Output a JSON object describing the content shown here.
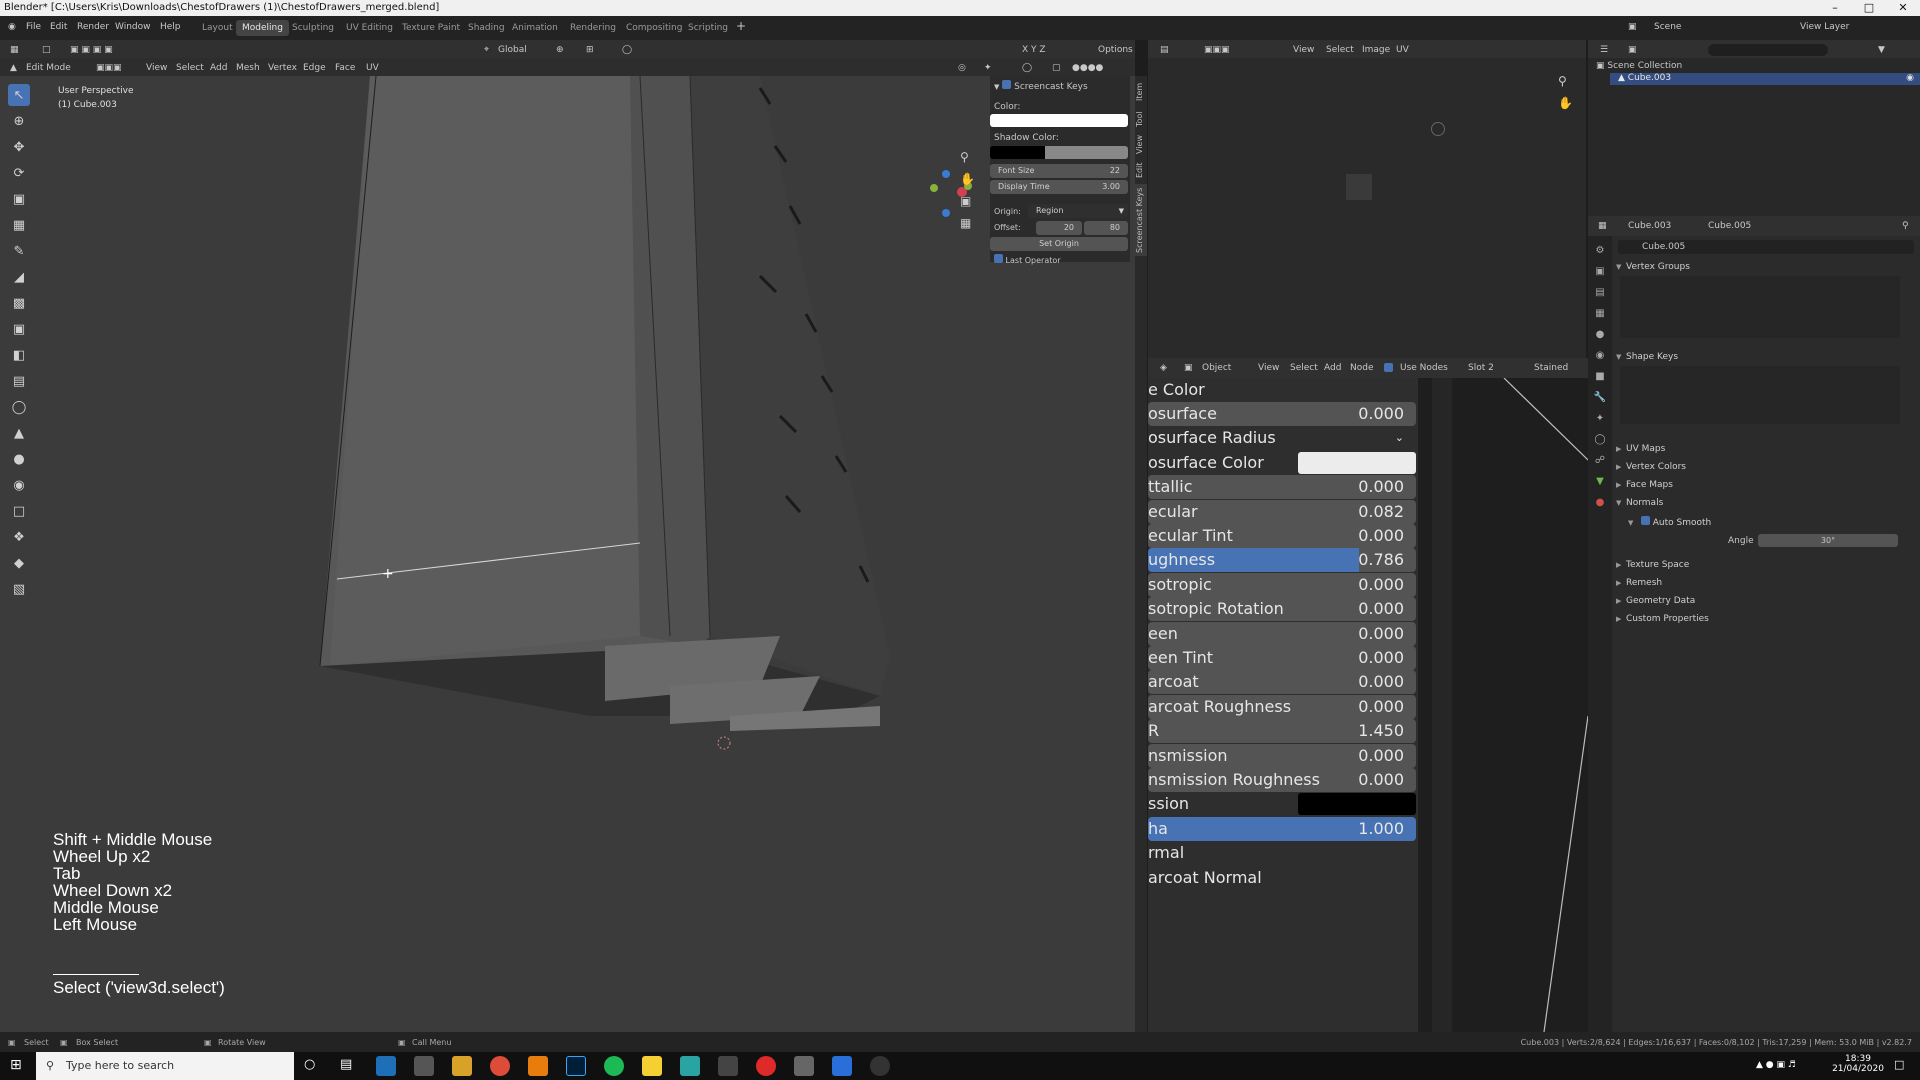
{
  "window": {
    "title": "Blender* [C:\\Users\\Kris\\Downloads\\ChestofDrawers (1)\\ChestofDrawers_merged.blend]"
  },
  "menubar": {
    "items": [
      "File",
      "Edit",
      "Render",
      "Window",
      "Help"
    ],
    "workspaces": [
      "Layout",
      "Modeling",
      "Sculpting",
      "UV Editing",
      "Texture Paint",
      "Shading",
      "Animation",
      "Rendering",
      "Compositing",
      "Scripting"
    ],
    "active_workspace": "Modeling",
    "scene_label": "Scene",
    "view_layer_label": "View Layer"
  },
  "viewport_header": {
    "orientation": "Global",
    "options": "Options",
    "mode": "Edit Mode",
    "menus": [
      "View",
      "Select",
      "Add",
      "Mesh",
      "Vertex",
      "Edge",
      "Face",
      "UV"
    ]
  },
  "viewport": {
    "view_name": "User Perspective",
    "object_name": "(1) Cube.003",
    "screencast_keys": [
      "Shift + Middle Mouse",
      "Wheel Up x2",
      "Tab",
      "Wheel Down x2",
      "Middle Mouse",
      "Left Mouse"
    ],
    "last_operator": "Select ('view3d.select')"
  },
  "npanel": {
    "title": "Screencast Keys",
    "color_label": "Color:",
    "shadow_color_label": "Shadow Color:",
    "font_size_label": "Font Size",
    "font_size_value": "22",
    "display_time_label": "Display Time",
    "display_time_value": "3.00",
    "origin_label": "Origin:",
    "origin_value": "Region",
    "offset_label": "Offset:",
    "offset_x": "20",
    "offset_y": "80",
    "set_origin": "Set Origin",
    "last_operator": "Last Operator",
    "tabs": [
      "Item",
      "Tool",
      "View",
      "Edit",
      "Screencast Keys"
    ]
  },
  "image_editor_header": {
    "menus": [
      "View",
      "Select",
      "Image",
      "UV"
    ]
  },
  "node_editor_header": {
    "object": "Object",
    "menus": [
      "View",
      "Select",
      "Add",
      "Node"
    ],
    "use_nodes": "Use Nodes",
    "slot": "Slot 2",
    "material": "Stained"
  },
  "bsdf": {
    "rows": [
      {
        "label": "e Color",
        "type": "header"
      },
      {
        "label": "osurface",
        "value": "0.000",
        "type": "num"
      },
      {
        "label": "osurface Radius",
        "type": "dropdown"
      },
      {
        "label": "osurface Color",
        "type": "color",
        "color": "#ececec"
      },
      {
        "label": "ttallic",
        "value": "0.000",
        "type": "num"
      },
      {
        "label": "ecular",
        "value": "0.082",
        "type": "num"
      },
      {
        "label": "ecular Tint",
        "value": "0.000",
        "type": "num"
      },
      {
        "label": "ughness",
        "value": "0.786",
        "type": "slider",
        "fill": 0.786
      },
      {
        "label": "sotropic",
        "value": "0.000",
        "type": "num"
      },
      {
        "label": "sotropic Rotation",
        "value": "0.000",
        "type": "num"
      },
      {
        "label": "een",
        "value": "0.000",
        "type": "num"
      },
      {
        "label": "een Tint",
        "value": "0.000",
        "type": "num"
      },
      {
        "label": "arcoat",
        "value": "0.000",
        "type": "num"
      },
      {
        "label": "arcoat Roughness",
        "value": "0.000",
        "type": "num"
      },
      {
        "label": "R",
        "value": "1.450",
        "type": "num"
      },
      {
        "label": "nsmission",
        "value": "0.000",
        "type": "num"
      },
      {
        "label": "nsmission Roughness",
        "value": "0.000",
        "type": "num"
      },
      {
        "label": "ssion",
        "type": "color",
        "color": "#000000"
      },
      {
        "label": "ha",
        "value": "1.000",
        "type": "slider",
        "fill": 1.0
      },
      {
        "label": "rmal",
        "type": "header"
      },
      {
        "label": "arcoat Normal",
        "type": "header"
      }
    ]
  },
  "outliner": {
    "collection": "Scene Collection",
    "object": "Cube.003"
  },
  "properties": {
    "object": "Cube.003",
    "mesh": "Cube.005",
    "datablock": "Cube.005",
    "sections": [
      "Vertex Groups",
      "Shape Keys",
      "UV Maps",
      "Vertex Colors",
      "Face Maps",
      "Normals",
      "Texture Space",
      "Remesh",
      "Geometry Data",
      "Custom Properties"
    ],
    "auto_smooth": "Auto Smooth",
    "angle_label": "Angle",
    "angle_value": "30°"
  },
  "statusbar": {
    "select": "Select",
    "box_select": "Box Select",
    "rotate_view": "Rotate View",
    "call_menu": "Call Menu",
    "stats": "Cube.003 | Verts:2/8,624 | Edges:1/16,637 | Faces:0/8,102 | Tris:17,259 | Mem: 53.0 MiB | v2.82.7"
  },
  "taskbar": {
    "search_placeholder": "Type here to search",
    "time": "18:39",
    "date": "21/04/2020"
  },
  "colors": {
    "accent": "#4772b3",
    "viewport_bg": "#3b3b3b",
    "panel_bg": "#2b2b2b"
  }
}
